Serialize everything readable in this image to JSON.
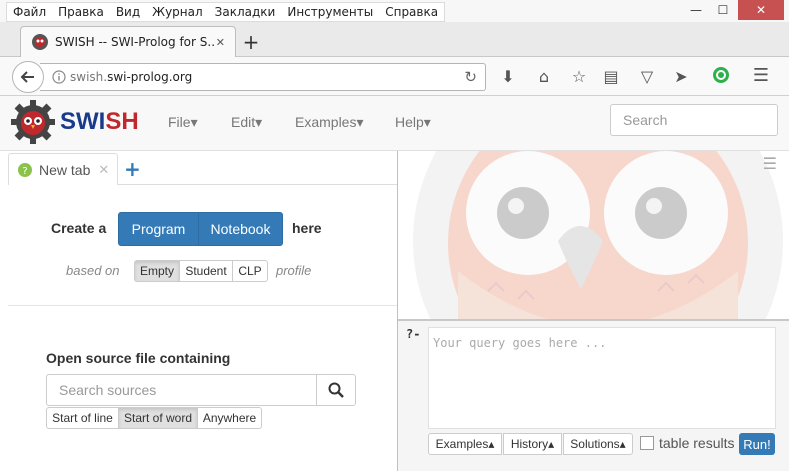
{
  "window_menu": {
    "items": [
      "Файл",
      "Правка",
      "Вид",
      "Журнал",
      "Закладки",
      "Инструменты",
      "Справка"
    ],
    "minimize": "—",
    "maximize": "☐",
    "close": "✕"
  },
  "browser_tab": {
    "title": "SWISH -- SWI-Prolog for S...",
    "close": "✕",
    "new_tab": "+"
  },
  "navbar": {
    "url_prefix": "swish.",
    "url_domain": "swi-prolog.org"
  },
  "swish_header": {
    "logo_swi": "SWI",
    "logo_sh": "SH",
    "menus": [
      "File",
      "Edit",
      "Examples",
      "Help"
    ],
    "search_placeholder": "Search"
  },
  "left": {
    "tab_label": "New tab",
    "tab_close": "✕",
    "tab_add": "+",
    "create_a": "Create a",
    "program": "Program",
    "notebook": "Notebook",
    "here": "here",
    "based_on": "based on",
    "profiles": [
      "Empty",
      "Student",
      "CLP"
    ],
    "profile_word": "profile",
    "open_source_title": "Open source file containing",
    "search_sources_placeholder": "Search sources",
    "match_modes": [
      "Start of line",
      "Start of word",
      "Anywhere"
    ]
  },
  "right": {
    "prompt": "?-",
    "query_placeholder": "Your query goes here ...",
    "buttons": [
      "Examples",
      "History",
      "Solutions"
    ],
    "table_results": "table results",
    "run": "Run!"
  },
  "colors": {
    "primary": "#337ab7",
    "logo_blue": "#1a3a8c",
    "logo_red": "#c0282d",
    "close_red": "#c75050"
  }
}
